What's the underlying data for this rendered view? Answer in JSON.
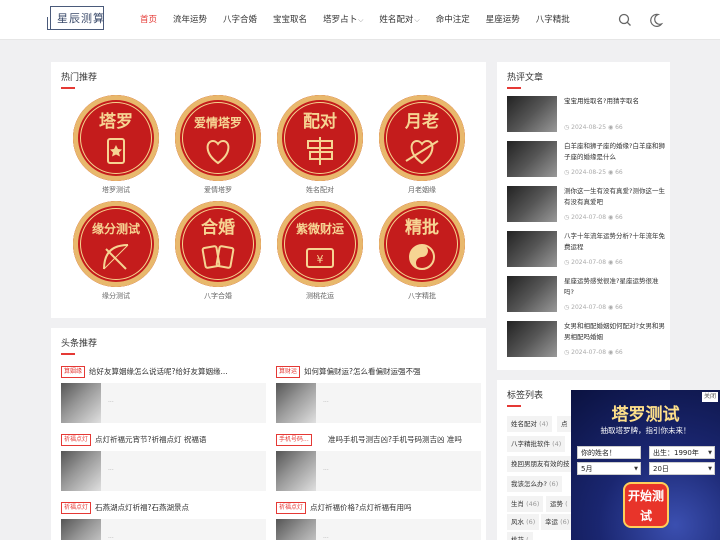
{
  "logo": {
    "text": "星辰测算"
  },
  "nav": {
    "items": [
      {
        "label": "首页",
        "active": true,
        "dropdown": false
      },
      {
        "label": "流年运势",
        "active": false,
        "dropdown": false
      },
      {
        "label": "八字合婚",
        "active": false,
        "dropdown": false
      },
      {
        "label": "宝宝取名",
        "active": false,
        "dropdown": false
      },
      {
        "label": "塔罗占卜",
        "active": false,
        "dropdown": true
      },
      {
        "label": "姓名配对",
        "active": false,
        "dropdown": true
      },
      {
        "label": "命中注定",
        "active": false,
        "dropdown": false
      },
      {
        "label": "星座运势",
        "active": false,
        "dropdown": false
      },
      {
        "label": "八字精批",
        "active": false,
        "dropdown": false
      }
    ]
  },
  "hot": {
    "title": "热门推荐",
    "items": [
      {
        "badge": "塔罗",
        "label": "塔罗测试",
        "icon": "tarot-card-icon"
      },
      {
        "badge": "爱情塔罗",
        "label": "爱情塔罗",
        "icon": "heart-icon"
      },
      {
        "badge": "配对",
        "label": "姓名配对",
        "icon": "signpost-icon"
      },
      {
        "badge": "月老",
        "label": "月老姻缘",
        "icon": "heart-arrow-icon"
      },
      {
        "badge": "缘分测试",
        "label": "缘分测试",
        "icon": "bow-arrow-icon"
      },
      {
        "badge": "合婚",
        "label": "八字合婚",
        "icon": "cards-icon"
      },
      {
        "badge": "紫微财运",
        "label": "测桃花运",
        "icon": "wallet-icon"
      },
      {
        "badge": "精批",
        "label": "八字精批",
        "icon": "yin-yang-icon"
      }
    ]
  },
  "news": {
    "title": "头条推荐",
    "items": [
      {
        "tag": "算姻缘",
        "title": "给好友算姻缘怎么说话呢?给好友算姻缘..."
      },
      {
        "tag": "算财运",
        "title": "如何算偏财运?怎么看偏财运强不强"
      },
      {
        "tag": "祈福点灯",
        "title": "点灯祈福元宵节?祈福点灯 祝福语"
      },
      {
        "tag": "手机号码...",
        "title": "准吗手机号测吉凶?手机号码测吉凶 准吗"
      },
      {
        "tag": "祈福点灯",
        "title": "石燕湖点灯祈福?石燕湖景点"
      },
      {
        "tag": "祈福点灯",
        "title": "点灯祈福价格?点灯祈福有用吗"
      }
    ],
    "ellipsis": "..."
  },
  "reviews": {
    "title": "热评文章",
    "items": [
      {
        "title": "宝宝用姓取名?用猜字取名",
        "date": "2024-08-25",
        "views": "66"
      },
      {
        "title": "白羊座和狮子座的婚缘?白羊座和狮子座的婚缘是什么",
        "date": "2024-08-25",
        "views": "66"
      },
      {
        "title": "测你这一生有没有真爱?测你这一生有没有真爱吧",
        "date": "2024-07-08",
        "views": "66"
      },
      {
        "title": "八字十年流年运势分析?十年流年免费运程",
        "date": "2024-07-08",
        "views": "66"
      },
      {
        "title": "星座运势感觉很准?星座运势很准吗?",
        "date": "2024-07-08",
        "views": "66"
      },
      {
        "title": "女男和相配婚姻如何配对?女男和男男相配吗婚姻",
        "date": "2024-07-08",
        "views": "66"
      }
    ]
  },
  "tags": {
    "title": "标签列表",
    "items": [
      {
        "name": "姓名配对",
        "count": "(4)"
      },
      {
        "name": "点",
        "count": ""
      },
      {
        "name": "八字精批软件",
        "count": "(4)"
      },
      {
        "name": "挽回男朋友有效的技",
        "count": ""
      },
      {
        "name": "我该怎么办?",
        "count": "(6)"
      },
      {
        "name": "生肖",
        "count": "(46)"
      },
      {
        "name": "运势",
        "count": "("
      },
      {
        "name": "风水",
        "count": "(6)"
      },
      {
        "name": "幸运",
        "count": "(6)"
      },
      {
        "name": "桃花",
        "count": "("
      }
    ]
  },
  "ad": {
    "title": "塔罗测试",
    "subtitle": "抽取塔罗牌，指引你未来！",
    "close_label": "关闭",
    "name_placeholder": "你的姓名！",
    "birth_year": "出生：1990年",
    "month": "5月",
    "day": "20日",
    "button_label": "开始测试"
  },
  "colors": {
    "accent": "#e53935",
    "badge_red": "#c41c1c",
    "badge_gold": "#f6d493"
  }
}
